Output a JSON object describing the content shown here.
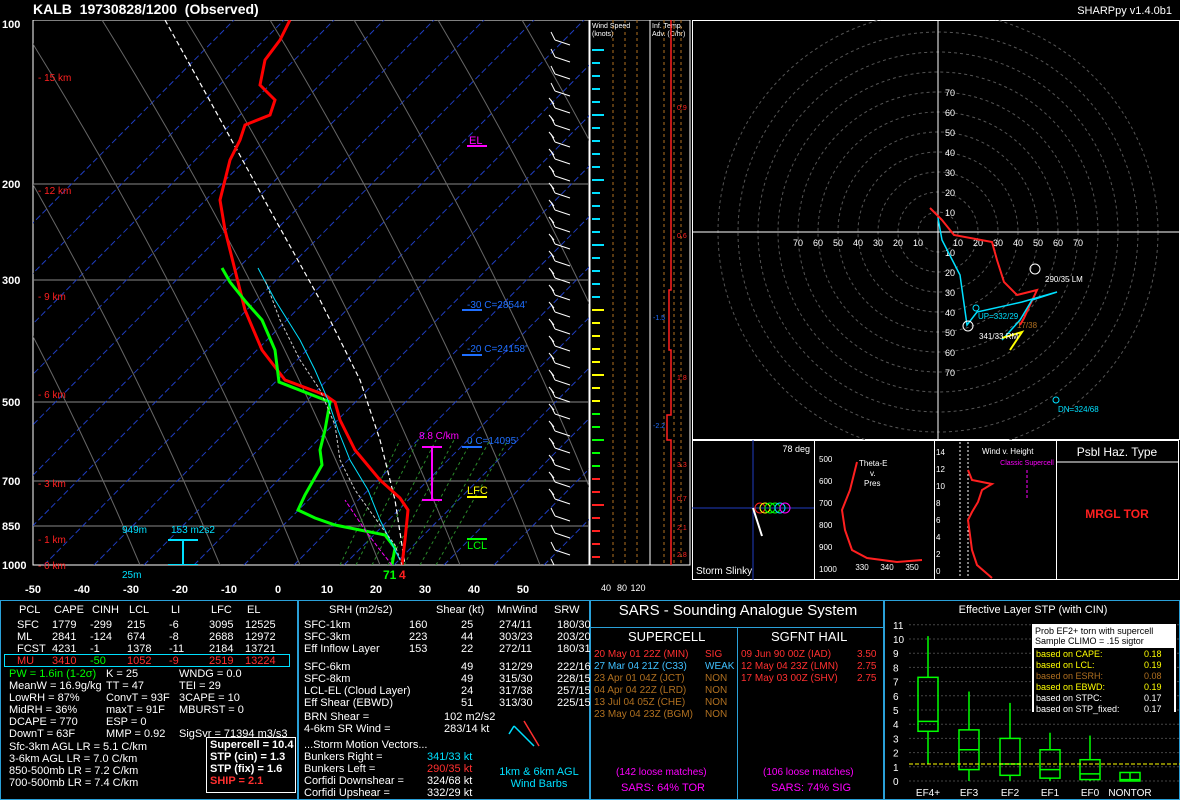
{
  "header": {
    "station": "KALB",
    "datetime": "19730828/1200",
    "status": "(Observed)",
    "version": "SHARPpy v1.4.0b1"
  },
  "skewt": {
    "p_labels": [
      "100",
      "200",
      "300",
      "500",
      "700",
      "850",
      "1000"
    ],
    "t_labels": [
      "-50",
      "-40",
      "-30",
      "-20",
      "-10",
      "0",
      "10",
      "20",
      "30",
      "40",
      "50"
    ],
    "heights": [
      "15 km",
      "12 km",
      "9 km",
      "6 km",
      "3 km",
      "1 km",
      "0 km"
    ],
    "el": "EL",
    "lfc": "LFC",
    "lcl": "LCL",
    "iso30": "-30 C=28544'",
    "iso20": "-20 C=24158'",
    "iso0": "0 C=14095'",
    "lapse": "8.8 C/km",
    "esrh_h": "949m",
    "esrh_v": "153 m2s2",
    "sfc_h": "25m",
    "sfc_td": "71",
    "sfc_t": "4"
  },
  "ws_panel": {
    "title": "Wind Speed (knots)",
    "ticks": [
      "40",
      "80",
      "120"
    ]
  },
  "ita_panel": {
    "title": "Inf. Temp. Adv. (C/hr)",
    "vals": [
      "0.9",
      "0.6",
      "-1.5",
      "1.8",
      "-2.2",
      "3.3",
      "0.7",
      "2.1",
      "2.8"
    ]
  },
  "hodo": {
    "rings": [
      "10",
      "20",
      "30",
      "40",
      "50",
      "60",
      "70"
    ],
    "lm": "290/35 LM",
    "up": "UP=332/29",
    "rm": "341/33 RM",
    "dn": "DN=324/68",
    "rm2": "17/38"
  },
  "slinky": {
    "label": "Storm Slinky",
    "deg": "78 deg"
  },
  "thetae": {
    "title1": "Theta-E",
    "title2": "v.",
    "title3": "Pres",
    "p": [
      "500",
      "600",
      "700",
      "800",
      "900",
      "1000"
    ],
    "x": [
      "330",
      "340",
      "350"
    ]
  },
  "windhgt": {
    "title": "Wind v. Height",
    "label": "Classic Supercell",
    "h": [
      "14",
      "12",
      "10",
      "8",
      "6",
      "4",
      "2",
      "0"
    ]
  },
  "haz": {
    "title": "Psbl Haz. Type",
    "value": "MRGL TOR"
  },
  "thermo": {
    "hdr": [
      "PCL",
      "CAPE",
      "CINH",
      "LCL",
      "LI",
      "LFC",
      "EL"
    ],
    "rows": [
      [
        "SFC",
        "1779",
        "-299",
        "215",
        "-6",
        "3095",
        "12525"
      ],
      [
        "ML",
        "2841",
        "-124",
        "674",
        "-8",
        "2688",
        "12972"
      ],
      [
        "FCST",
        "4231",
        "-1",
        "1378",
        "-11",
        "2184",
        "13721"
      ],
      [
        "MU",
        "3410",
        "-50",
        "1052",
        "-9",
        "2519",
        "13224"
      ]
    ],
    "a": [
      "PW = 1.6in (1-2σ)",
      "MeanW = 16.9g/kg",
      "LowRH = 87%",
      "MidRH = 36%",
      "DCAPE = 770",
      "DownT = 63F"
    ],
    "b": [
      "K = 25",
      "TT = 47",
      "ConvT = 93F",
      "maxT = 91F",
      "ESP = 0",
      "MMP = 0.92"
    ],
    "c": [
      "WNDG = 0.0",
      "TEI = 29",
      "3CAPE = 10",
      "MBURST = 0",
      "",
      "SigSvr = 71394 m3/s3"
    ],
    "lr": [
      "Sfc-3km AGL LR = 5.1 C/km",
      "3-6km AGL LR = 7.0 C/km",
      "850-500mb LR = 7.2 C/km",
      "700-500mb LR = 7.4 C/km"
    ],
    "comp": [
      "Supercell = 10.4",
      "STP (cin) = 1.3",
      "STP (fix) = 1.6",
      "SHIP = 2.1"
    ]
  },
  "kin": {
    "hdr": [
      "SRH (m2/s2)",
      "Shear (kt)",
      "MnWind",
      "SRW"
    ],
    "rows": [
      [
        "SFC-1km",
        "160",
        "25",
        "274/11",
        "180/30"
      ],
      [
        "SFC-3km",
        "223",
        "44",
        "303/23",
        "203/20"
      ],
      [
        "Eff Inflow Layer",
        "153",
        "22",
        "272/11",
        "180/31"
      ],
      [
        "SFC-6km",
        "",
        "49",
        "312/29",
        "222/16"
      ],
      [
        "SFC-8km",
        "",
        "49",
        "315/30",
        "228/15"
      ],
      [
        "LCL-EL (Cloud Layer)",
        "",
        "24",
        "317/38",
        "257/15"
      ],
      [
        "Eff Shear (EBWD)",
        "",
        "51",
        "313/30",
        "225/15"
      ]
    ],
    "brn": "BRN Shear =",
    "brnv": "102 m2/s2",
    "sr": "4-6km SR Wind =",
    "srv": "283/14 kt",
    "smv": "...Storm Motion Vectors...",
    "sm": [
      [
        "Bunkers Right =",
        "341/33 kt"
      ],
      [
        "Bunkers Left =",
        "290/35 kt"
      ],
      [
        "Corfidi Downshear =",
        "324/68 kt"
      ],
      [
        "Corfidi Upshear =",
        "332/29 kt"
      ]
    ],
    "barbs": "1km & 6km AGL Wind Barbs"
  },
  "sars": {
    "title": "SARS - Sounding Analogue System",
    "sc": "SUPERCELL",
    "hl": "SGFNT HAIL",
    "sc_rows": [
      [
        "20 May 01 22Z (MIN)",
        "SIG",
        "#ff3030"
      ],
      [
        "27 Mar 04 21Z (C33)",
        "WEAK",
        "#40c0ff"
      ],
      [
        "23 Apr 01 04Z (JCT)",
        "NON",
        "#b07020"
      ],
      [
        "04 Apr 04 22Z (LRD)",
        "NON",
        "#b07020"
      ],
      [
        "13 Jul 04 05Z (CHE)",
        "NON",
        "#b07020"
      ],
      [
        "23 May 04 23Z (BGM)",
        "NON",
        "#b07020"
      ]
    ],
    "hl_rows": [
      [
        "09 Jun 90 00Z (IAD)",
        "3.50"
      ],
      [
        "12 May 04 23Z (LMN)",
        "2.75"
      ],
      [
        "17 May 03 00Z (SHV)",
        "2.75"
      ]
    ],
    "sc_loose": "(142 loose matches)",
    "hl_loose": "(106 loose matches)",
    "sc_pct": "SARS: 64% TOR",
    "hl_pct": "SARS: 74% SIG"
  },
  "stp": {
    "title": "Effective Layer STP (with CIN)",
    "y": [
      "11",
      "10",
      "9",
      "8",
      "7",
      "6",
      "5",
      "4",
      "3",
      "2",
      "1",
      "0"
    ],
    "cats": [
      "EF4+",
      "EF3",
      "EF2",
      "EF1",
      "EF0",
      "NONTOR"
    ],
    "prob1": "Prob EF2+ torn with supercell",
    "prob2": "Sample CLIMO = .15 sigtor",
    "rows": [
      [
        "based on CAPE:",
        "0.18",
        "y"
      ],
      [
        "based on LCL:",
        "0.19",
        "y"
      ],
      [
        "based on ESRH:",
        "0.08",
        "g"
      ],
      [
        "based on EBWD:",
        "0.19",
        "y"
      ],
      [
        "based on STPC:",
        "0.17",
        "w"
      ],
      [
        "based on STP_fixed:",
        "0.17",
        "w"
      ]
    ]
  },
  "colors": {
    "panel_border": "#2aa0d8",
    "temp": "#ff0000",
    "dewp": "#00ff00",
    "cyan": "#00e0ff"
  }
}
